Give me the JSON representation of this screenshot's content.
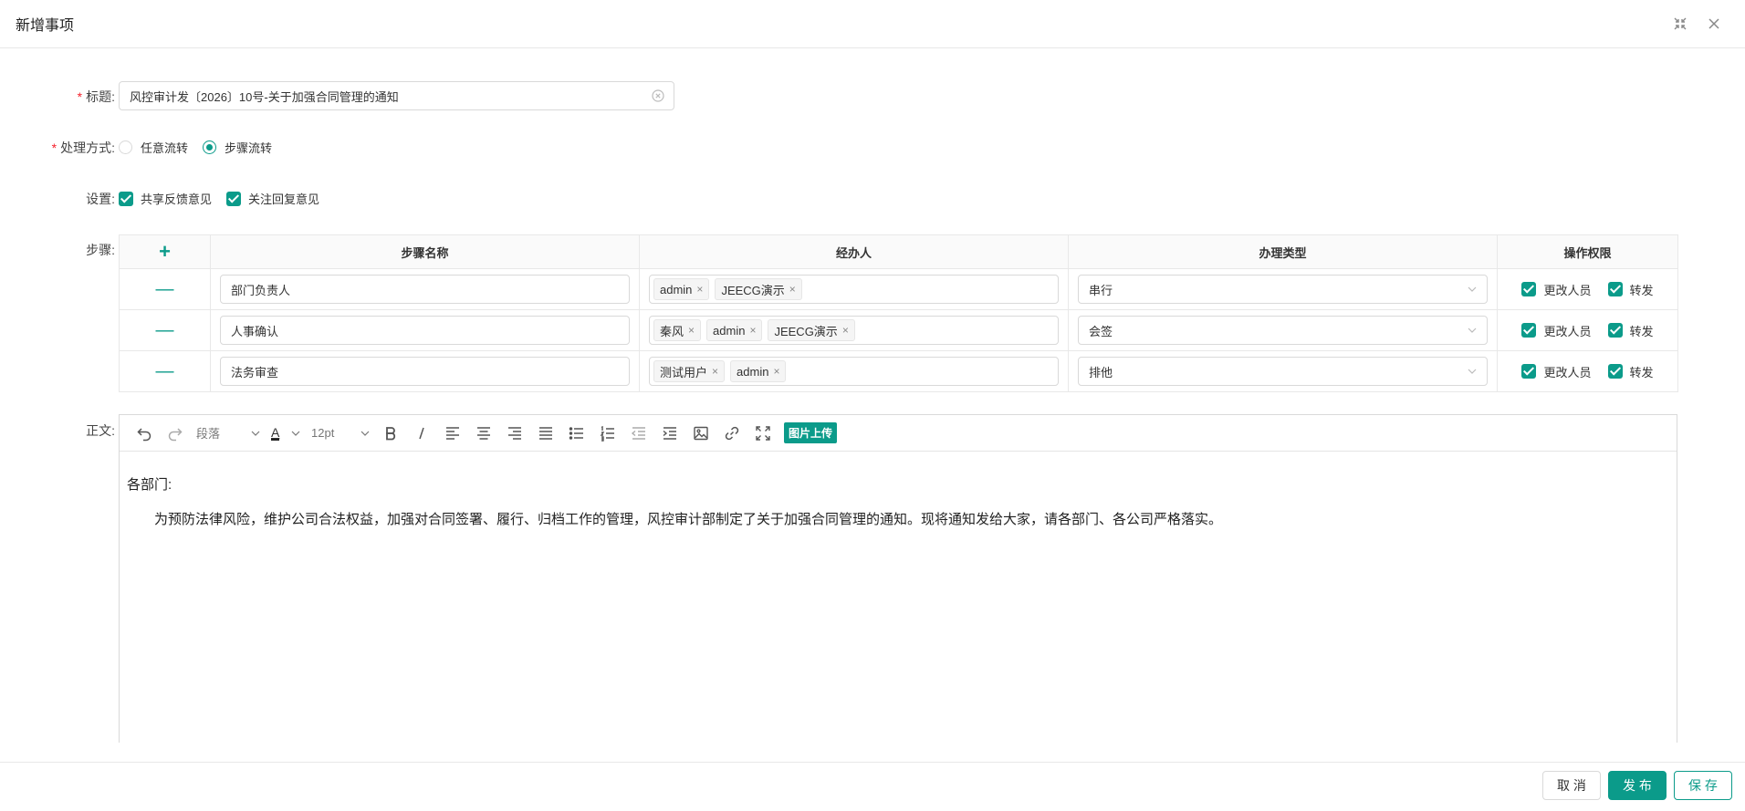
{
  "modal": {
    "title": "新增事项"
  },
  "form": {
    "title_label": "标题:",
    "title_value": "风控审计发〔2026〕10号-关于加强合同管理的通知",
    "mode_label": "处理方式:",
    "mode_options": [
      {
        "label": "任意流转",
        "checked": false
      },
      {
        "label": "步骤流转",
        "checked": true
      }
    ],
    "settings_label": "设置:",
    "settings_options": [
      {
        "label": "共享反馈意见",
        "checked": true
      },
      {
        "label": "关注回复意见",
        "checked": true
      }
    ],
    "steps_label": "步骤:",
    "body_label": "正文:"
  },
  "steps": {
    "add_symbol": "+",
    "remove_symbol": "—",
    "columns": [
      "步骤名称",
      "经办人",
      "办理类型",
      "操作权限"
    ],
    "rows": [
      {
        "name": "部门负责人",
        "handlers": [
          "admin",
          "JEECG演示"
        ],
        "type": "串行",
        "perms": [
          {
            "label": "更改人员",
            "checked": true
          },
          {
            "label": "转发",
            "checked": true
          }
        ]
      },
      {
        "name": "人事确认",
        "handlers": [
          "秦风",
          "admin",
          "JEECG演示"
        ],
        "type": "会签",
        "perms": [
          {
            "label": "更改人员",
            "checked": true
          },
          {
            "label": "转发",
            "checked": true
          }
        ]
      },
      {
        "name": "法务审查",
        "handlers": [
          "测试用户",
          "admin"
        ],
        "type": "排他",
        "perms": [
          {
            "label": "更改人员",
            "checked": true
          },
          {
            "label": "转发",
            "checked": true
          }
        ]
      }
    ]
  },
  "editor": {
    "paragraph_select": "段落",
    "font_size_select": "12pt",
    "upload_label": "图片上传",
    "content": [
      "各部门:",
      "为预防法律风险，维护公司合法权益，加强对合同签署、履行、归档工作的管理，风控审计部制定了关于加强合同管理的通知。现将通知发给大家，请各部门、各公司严格落实。"
    ]
  },
  "footer": {
    "cancel": "取 消",
    "publish": "发 布",
    "save": "保 存"
  },
  "colors": {
    "accent": "#0b9b8a",
    "required": "#f5222d"
  }
}
